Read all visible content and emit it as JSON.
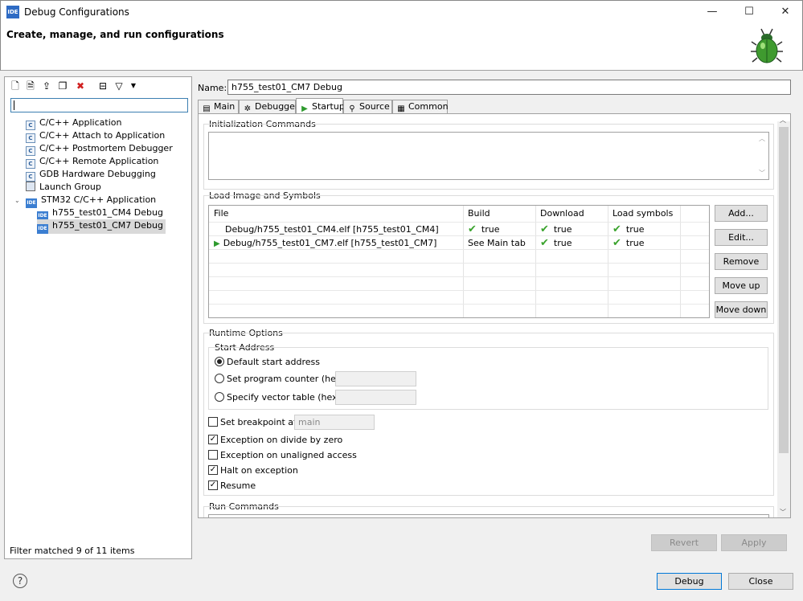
{
  "window": {
    "title": "Debug Configurations",
    "icon": "ide-app-icon",
    "controls": {
      "minimize": "—",
      "maximize": "☐",
      "close": "✕"
    }
  },
  "header": {
    "title": "Create, manage, and run configurations",
    "graphic": "bug-icon"
  },
  "toolbar": {
    "icons": [
      "new-config-icon",
      "new-prototype-icon",
      "export-icon",
      "duplicate-icon",
      "delete-icon",
      "collapse-all-icon",
      "filter-icon",
      "dropdown-icon"
    ]
  },
  "left": {
    "filter_value": "",
    "tree": [
      {
        "label": "C/C++ Application",
        "icon": "c-config-icon"
      },
      {
        "label": "C/C++ Attach to Application",
        "icon": "c-config-icon"
      },
      {
        "label": "C/C++ Postmortem Debugger",
        "icon": "c-config-icon"
      },
      {
        "label": "C/C++ Remote Application",
        "icon": "c-config-icon"
      },
      {
        "label": "GDB Hardware Debugging",
        "icon": "c-config-icon"
      },
      {
        "label": "Launch Group",
        "icon": "launch-group-icon"
      },
      {
        "label": "STM32 C/C++ Application",
        "icon": "ide-icon",
        "expanded": true
      },
      {
        "label": "h755_test01_CM4 Debug",
        "icon": "ide-icon"
      },
      {
        "label": "h755_test01_CM7 Debug",
        "icon": "ide-icon",
        "selected": true
      }
    ],
    "status": "Filter matched 9 of 11 items"
  },
  "name": {
    "label": "Name:",
    "value": "h755_test01_CM7 Debug"
  },
  "tabs": [
    {
      "label": "Main",
      "icon": "main-tab-icon"
    },
    {
      "label": "Debugger",
      "icon": "debugger-tab-icon"
    },
    {
      "label": "Startup",
      "icon": "startup-tab-icon",
      "active": true
    },
    {
      "label": "Source",
      "icon": "source-tab-icon"
    },
    {
      "label": "Common",
      "icon": "common-tab-icon"
    }
  ],
  "startup": {
    "init_commands": {
      "label": "Initialization Commands",
      "value": ""
    },
    "load": {
      "label": "Load Image and Symbols",
      "columns": [
        "File",
        "Build",
        "Download",
        "Load symbols"
      ],
      "rows": [
        {
          "file": "Debug/h755_test01_CM4.elf [h755_test01_CM4]",
          "build": "true",
          "download": "true",
          "symbols": "true",
          "active": false
        },
        {
          "file": "Debug/h755_test01_CM7.elf [h755_test01_CM7]",
          "build": "See Main tab",
          "download": "true",
          "symbols": "true",
          "active": true
        }
      ],
      "buttons": {
        "add": "Add...",
        "edit": "Edit...",
        "remove": "Remove",
        "move_up": "Move up",
        "move_down": "Move down"
      }
    },
    "runtime": {
      "label": "Runtime Options",
      "start_address": {
        "label": "Start Address",
        "options": [
          "Default start address",
          "Set program counter (hex):",
          "Specify vector table (hex):"
        ],
        "selected": 0
      },
      "breakpoint": {
        "label": "Set breakpoint at:",
        "value": "main",
        "checked": false
      },
      "checks": [
        {
          "label": "Exception on divide by zero",
          "checked": true
        },
        {
          "label": "Exception on unaligned access",
          "checked": false
        },
        {
          "label": "Halt on exception",
          "checked": true
        },
        {
          "label": "Resume",
          "checked": true
        }
      ]
    },
    "run_commands": {
      "label": "Run Commands"
    }
  },
  "actions": {
    "revert": "Revert",
    "apply": "Apply",
    "debug": "Debug",
    "close": "Close",
    "help": "?"
  }
}
